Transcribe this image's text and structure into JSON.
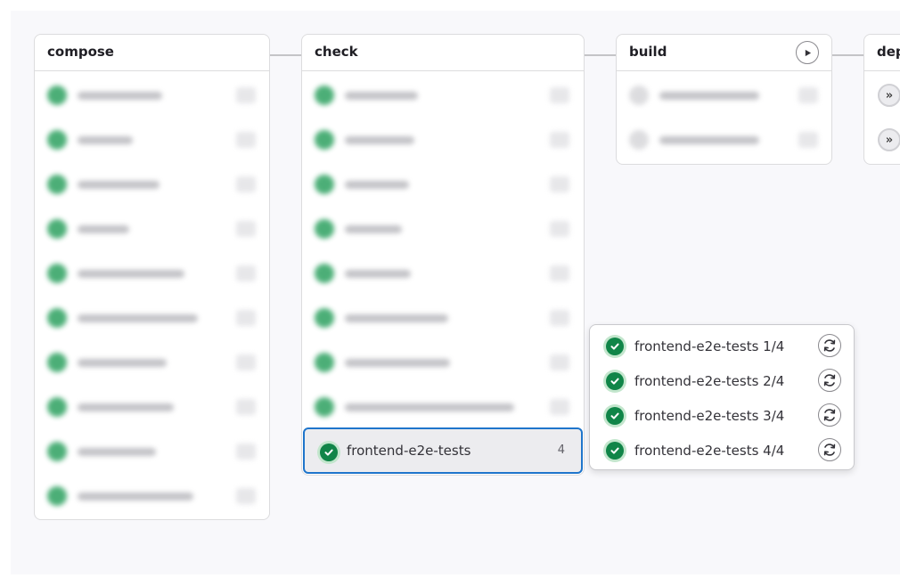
{
  "stages": {
    "compose": {
      "title": "compose"
    },
    "check": {
      "title": "check"
    },
    "build": {
      "title": "build"
    },
    "deploy": {
      "title": "dep"
    }
  },
  "active_job": {
    "name": "frontend-e2e-tests",
    "count": "4"
  },
  "parallel_jobs": [
    {
      "name": "frontend-e2e-tests 1/4",
      "status": "success"
    },
    {
      "name": "frontend-e2e-tests 2/4",
      "status": "success"
    },
    {
      "name": "frontend-e2e-tests 3/4",
      "status": "success"
    },
    {
      "name": "frontend-e2e-tests 4/4",
      "status": "success"
    }
  ],
  "colors": {
    "success": "#108548",
    "focus": "#1f75cb",
    "connector": "#c4c4c7"
  },
  "icons": {
    "status": "check-circle-icon",
    "retry": "retry-icon",
    "play": "play-icon",
    "downstream": "chevron-double-right-icon"
  }
}
